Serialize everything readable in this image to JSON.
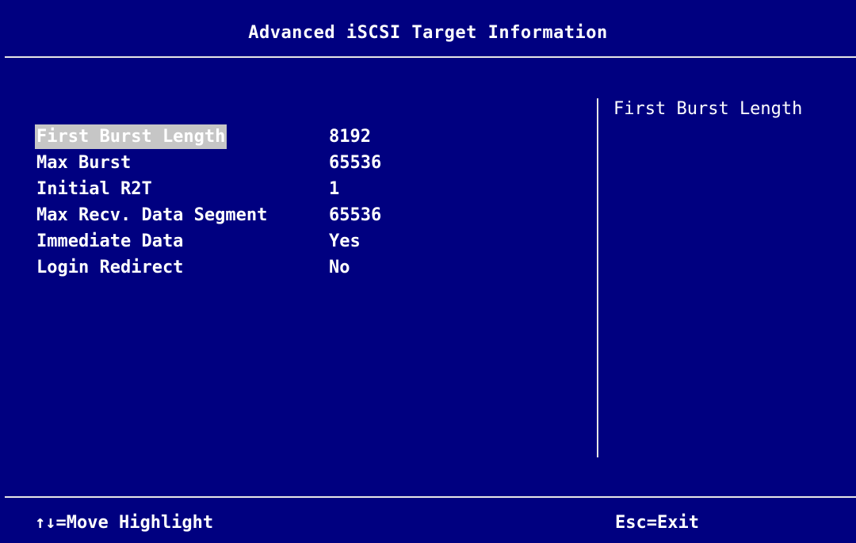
{
  "header": {
    "title": "Advanced iSCSI Target Information"
  },
  "settings": [
    {
      "label": "First Burst Length",
      "value": "8192",
      "selected": true
    },
    {
      "label": "Max Burst",
      "value": "65536",
      "selected": false
    },
    {
      "label": "Initial R2T",
      "value": "1",
      "selected": false
    },
    {
      "label": "Max Recv. Data Segment",
      "value": "65536",
      "selected": false
    },
    {
      "label": "Immediate Data",
      "value": "Yes",
      "selected": false
    },
    {
      "label": "Login Redirect",
      "value": "No",
      "selected": false
    }
  ],
  "help_panel": {
    "text": "First Burst Length"
  },
  "footer": {
    "left_hint": "↑↓=Move Highlight",
    "right_hint": "Esc=Exit"
  },
  "colors": {
    "background": "#000080",
    "text": "#ffffff",
    "highlight": "#c6c6c6",
    "divider": "#e6e6e6"
  }
}
